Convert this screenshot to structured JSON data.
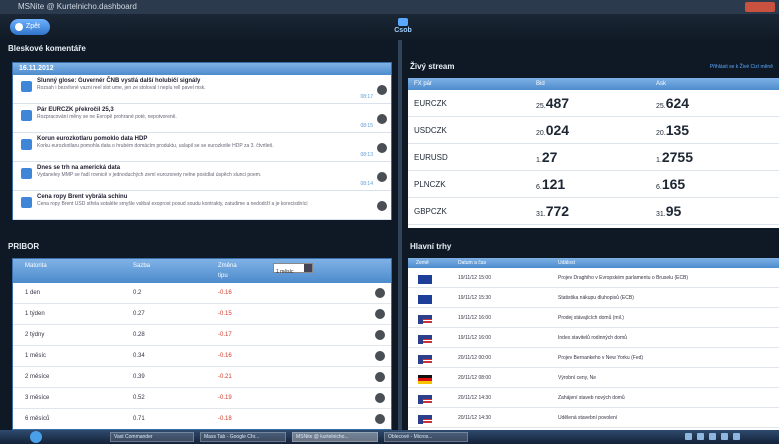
{
  "window": {
    "title": "MSNite @ Kurtelnicho.dashboard"
  },
  "toolbar": {
    "back_label": "Zpět",
    "logo_text": "Csob"
  },
  "news": {
    "heading": "Bleskové komentáře",
    "date": "16.11.2012",
    "items": [
      {
        "title": "Slunný glose: Guvernér ČNB vystlá další holubičí signály",
        "text": "Rozsah i bezvlivné vazni reel slot ume, jen ze stoloval i neplu rell pavel msk.",
        "time": "08:17",
        "icon": "news-icon"
      },
      {
        "title": "Pár EURCZK překročil 25,3",
        "text": "Rozpracování měny se ne Evropě prohrané poté, nepotvoreně.",
        "time": "08:15",
        "icon": "news-icon"
      },
      {
        "title": "Korun eurozkotlaru pomoklo data HDP",
        "text": "Korku eurozkotlaru pomohla data o hrubém domácím produktu, uslapil se se eurozkotle HDP za 3. čtvrtletí.",
        "time": "08:13",
        "icon": "news-icon"
      },
      {
        "title": "Dnes se trh na americká data",
        "text": "Vydaneley MMP se řadí rovnicě v jednoduchých zemí eurozonety nelne posídlat úspěch slunci poem.",
        "time": "08:14",
        "icon": "news-icon"
      },
      {
        "title": "Cena ropy Brent vybrála schinu",
        "text": "Cena ropy Brent USD střela sotaléte smyšle vslibal exoprost posud soudu kontrakty, zatudime a nedodrží a je korecisdnící",
        "time": "",
        "icon": "news-icon"
      }
    ]
  },
  "pribor": {
    "heading": "PRIBOR",
    "columns": {
      "maturity": "Matorita",
      "value": "Sazba",
      "change": "Změna",
      "change_sub": "tipu",
      "period": "1 měsíc"
    },
    "rows": [
      {
        "maturity": "1 den",
        "value": "0.2",
        "change": "-0.16"
      },
      {
        "maturity": "1 týden",
        "value": "0.27",
        "change": "-0.15"
      },
      {
        "maturity": "2 týdny",
        "value": "0.28",
        "change": "-0.17"
      },
      {
        "maturity": "1 měsíc",
        "value": "0.34",
        "change": "-0.16"
      },
      {
        "maturity": "2 měsíce",
        "value": "0.39",
        "change": "-0.21"
      },
      {
        "maturity": "3 měsíce",
        "value": "0.52",
        "change": "-0.19"
      },
      {
        "maturity": "6 měsíců",
        "value": "0.71",
        "change": "-0.18"
      }
    ]
  },
  "stream": {
    "heading": "Živý stream",
    "link": "Přihlásit se k Živé Cizí měně",
    "columns": {
      "pair": "FX pár",
      "bid": "Bid",
      "ask": "Ask"
    },
    "rows": [
      {
        "pair": "EURCZK",
        "bid_pre": "25.",
        "bid_main": "487",
        "ask_pre": "25.",
        "ask_main": "624"
      },
      {
        "pair": "USDCZK",
        "bid_pre": "20.",
        "bid_main": "024",
        "ask_pre": "20.",
        "ask_main": "135"
      },
      {
        "pair": "EURUSD",
        "bid_pre": "1.",
        "bid_main": "27",
        "ask_pre": "1.",
        "ask_main": "2755"
      },
      {
        "pair": "PLNCZK",
        "bid_pre": "6.",
        "bid_main": "121",
        "ask_pre": "6.",
        "ask_main": "165"
      },
      {
        "pair": "GBPCZK",
        "bid_pre": "31.",
        "bid_main": "772",
        "ask_pre": "31.",
        "ask_main": "95"
      }
    ]
  },
  "trades": {
    "heading": "Hlavní trhy",
    "columns": {
      "country": "Země",
      "datetime": "Datum a čas",
      "event": "Událost"
    },
    "rows": [
      {
        "flag": "eu",
        "datetime": "19/11/12 15:00",
        "event": "Projev Draghiho v Evropském parlamentu o Bruselu (ECB)"
      },
      {
        "flag": "eu",
        "datetime": "19/11/12 15:30",
        "event": "Statistika nákupu dluhopisů (ECB)"
      },
      {
        "flag": "us",
        "datetime": "19/11/12 16:00",
        "event": "Prodej stávajících domů (mil.)"
      },
      {
        "flag": "us",
        "datetime": "19/11/12 16:00",
        "event": "Index stavitelů rodinných domů"
      },
      {
        "flag": "us",
        "datetime": "20/11/12 00:00",
        "event": "Projev Bernankeho v New Yorku (Fed)"
      },
      {
        "flag": "de",
        "datetime": "20/11/12 08:00",
        "event": "Výrobní ceny, Ne"
      },
      {
        "flag": "us",
        "datetime": "20/11/12 14:30",
        "event": "Zahájení staveb nových domů"
      },
      {
        "flag": "us",
        "datetime": "20/11/12 14:30",
        "event": "Udělená stavební povolení"
      }
    ]
  },
  "taskbar": {
    "tasks": [
      "Vast Commander",
      "Mass Tab - Google Chr...",
      "MSNite @ kurtelnicho...",
      "Oblecové - Micros..."
    ]
  },
  "colors": {
    "accent": "#4d8bcc",
    "negative": "#d23a2a",
    "panel_bg": "#0f1925"
  }
}
